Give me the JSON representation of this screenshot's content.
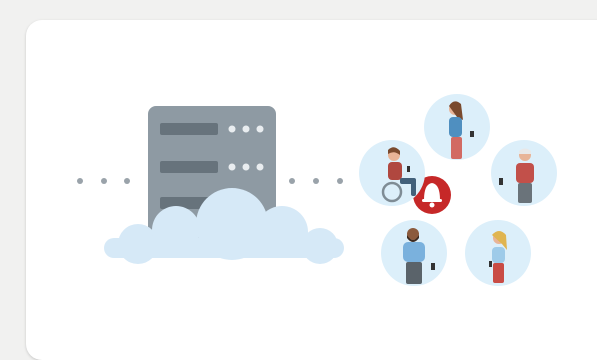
{
  "banner": {
    "cut_text": "… … … … … … … … … … … … … … … … …"
  },
  "colors": {
    "server": "#8e9aa3",
    "cloud": "#d6e9f7",
    "circle": "#dceffa",
    "bell_bg": "#c62828",
    "dots": "#9aa3aa"
  },
  "icons": {
    "server": "server-icon",
    "cloud": "cloud-icon",
    "bell": "bell-icon"
  }
}
